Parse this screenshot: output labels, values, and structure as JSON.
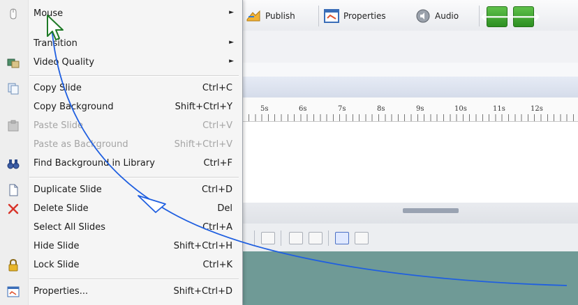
{
  "toolbar": {
    "publish_label": "Publish",
    "properties_label": "Properties",
    "audio_label": "Audio",
    "back_glyph": "🡐",
    "forward_glyph": "🡒"
  },
  "timeline": {
    "ruler_labels": [
      "5s",
      "6s",
      "7s",
      "8s",
      "9s",
      "10s",
      "11s",
      "12s"
    ]
  },
  "context_menu": {
    "items": [
      {
        "label": "Mouse",
        "shortcut": "",
        "submenu": true,
        "enabled": true,
        "icon": "mouse-icon"
      },
      {
        "label": "Transition",
        "shortcut": "",
        "submenu": true,
        "enabled": true,
        "icon": ""
      },
      {
        "label": "Video Quality",
        "shortcut": "",
        "submenu": true,
        "enabled": true,
        "icon": "video-quality-icon"
      },
      {
        "label": "Copy Slide",
        "shortcut": "Ctrl+C",
        "submenu": false,
        "enabled": true,
        "icon": "copy-icon"
      },
      {
        "label": "Copy Background",
        "shortcut": "Shift+Ctrl+Y",
        "submenu": false,
        "enabled": true,
        "icon": ""
      },
      {
        "label": "Paste Slide",
        "shortcut": "Ctrl+V",
        "submenu": false,
        "enabled": false,
        "icon": "paste-icon"
      },
      {
        "label": "Paste as Background",
        "shortcut": "Shift+Ctrl+V",
        "submenu": false,
        "enabled": false,
        "icon": ""
      },
      {
        "label": "Find Background in Library",
        "shortcut": "Ctrl+F",
        "submenu": false,
        "enabled": true,
        "icon": "binoculars-icon"
      },
      {
        "label": "Duplicate Slide",
        "shortcut": "Ctrl+D",
        "submenu": false,
        "enabled": true,
        "icon": "duplicate-icon"
      },
      {
        "label": "Delete Slide",
        "shortcut": "Del",
        "submenu": false,
        "enabled": true,
        "icon": "delete-x-icon"
      },
      {
        "label": "Select All Slides",
        "shortcut": "Ctrl+A",
        "submenu": false,
        "enabled": true,
        "icon": ""
      },
      {
        "label": "Hide Slide",
        "shortcut": "Shift+Ctrl+H",
        "submenu": false,
        "enabled": true,
        "icon": ""
      },
      {
        "label": "Lock Slide",
        "shortcut": "Ctrl+K",
        "submenu": false,
        "enabled": true,
        "icon": "lock-icon"
      },
      {
        "label": "Properties...",
        "shortcut": "Shift+Ctrl+D",
        "submenu": false,
        "enabled": true,
        "icon": "properties-icon"
      }
    ],
    "submenu_arrow": "►"
  },
  "annotation": {
    "arrow_color": "#1f5fe0"
  }
}
